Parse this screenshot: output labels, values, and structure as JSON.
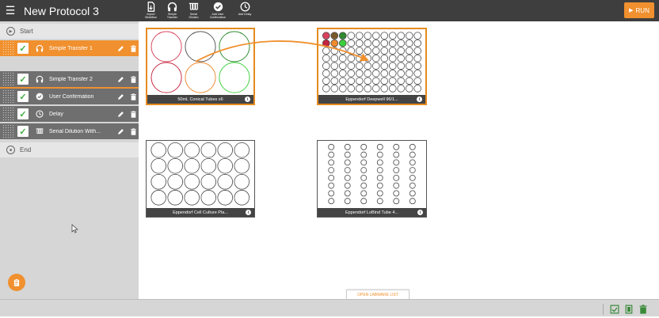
{
  "app": {
    "title": "New Protocol 3"
  },
  "toolbar": {
    "items": [
      {
        "label": "Import\nWorkflow",
        "icon": "import-icon"
      },
      {
        "label": "Simple\nTransfer",
        "icon": "headphones-icon"
      },
      {
        "label": "Serial\nDilution",
        "icon": "serial-dilution-icon"
      },
      {
        "label": "Add User\nConfirmation",
        "icon": "check-circle-icon"
      },
      {
        "label": "Add Delay",
        "icon": "clock-icon"
      }
    ],
    "run_label": "RUN"
  },
  "sidebar": {
    "start_label": "Start",
    "end_label": "End",
    "steps": [
      {
        "label": "Simple Transfer 1",
        "icon": "headphones-icon",
        "active": true
      },
      {
        "label": "Simple Transfer 2",
        "icon": "headphones-icon",
        "active": false
      },
      {
        "label": "User Confirmation",
        "icon": "check-circle-icon",
        "active": false
      },
      {
        "label": "Delay",
        "icon": "clock-icon",
        "active": false
      },
      {
        "label": "Serial Dilution With...",
        "icon": "serial-dilution-icon",
        "active": false
      }
    ]
  },
  "labware": [
    {
      "name": "50mL Conical Tubes x6",
      "kind": "tubes6",
      "selected": true
    },
    {
      "name": "Eppendorf Deepwell 96/1...",
      "kind": "plate96",
      "selected": true
    },
    {
      "name": "Eppendorf Cell Culture Pla...",
      "kind": "plate24",
      "selected": false
    },
    {
      "name": "Eppendorf LoBind Tube 4...",
      "kind": "rack48",
      "selected": false
    }
  ],
  "open_labware_list": "OPEN LABWARE LIST",
  "colors": {
    "accent": "#f0902e",
    "topbar": "#3e3e3e",
    "sidebar": "#d6d6d6",
    "step": "#6f6f6f"
  }
}
